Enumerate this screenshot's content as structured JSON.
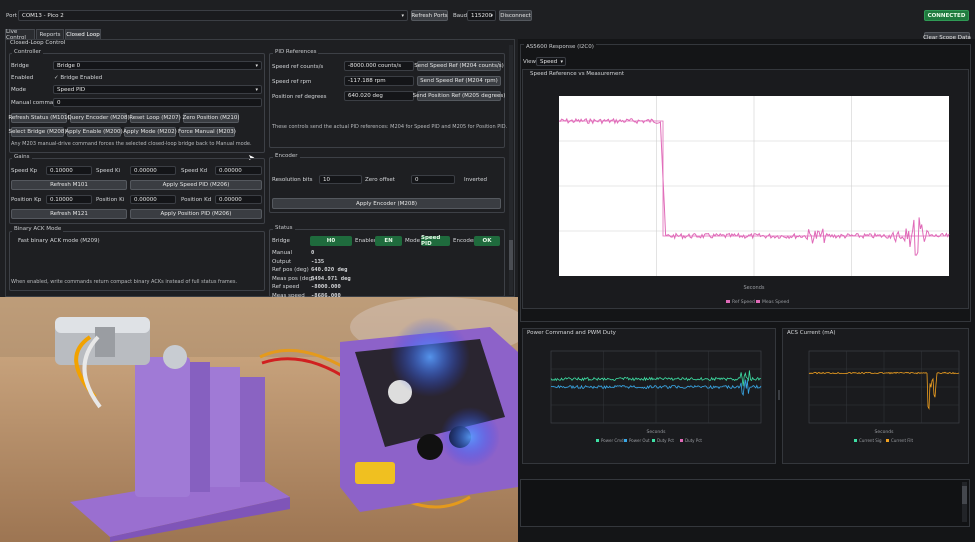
{
  "topbar": {
    "port_label": "Port",
    "port_value": "COM13 - Pico 2",
    "refresh_ports": "Refresh Ports",
    "baud_label": "Baud",
    "baud_value": "115200",
    "disconnect": "Disconnect",
    "status": "CONNECTED",
    "clear_scope": "Clear Scope Data"
  },
  "tabs": [
    "Live Control",
    "Reports",
    "Closed Loop"
  ],
  "closed_loop": {
    "title": "Closed-Loop Control",
    "controller": {
      "title": "Controller",
      "bridge_label": "Bridge",
      "bridge_value": "Bridge 0",
      "enabled_label": "Enabled",
      "enabled_check": "✓ Bridge Enabled",
      "mode_label": "Mode",
      "mode_value": "Speed PID",
      "manual_label": "Manual command",
      "manual_value": "0",
      "buttons_row1": [
        "Refresh Status (M101)",
        "Query Encoder (M208)",
        "Reset Loop (M207)",
        "Zero Position (M210)"
      ],
      "buttons_row2": [
        "Select Bridge (M208)",
        "Apply Enable (M200)",
        "Apply Mode (M202)",
        "Force Manual (M203)"
      ],
      "note": "Any M203 manual-drive command forces the selected closed-loop bridge back to Manual mode."
    },
    "gains": {
      "title": "Gains",
      "speed_kp_label": "Speed Kp",
      "speed_kp": "0.10000",
      "speed_ki_label": "Speed Ki",
      "speed_ki": "0.00000",
      "speed_kd_label": "Speed Kd",
      "speed_kd": "0.00000",
      "refresh_m101": "Refresh M101",
      "apply_speed": "Apply Speed PID (M206)",
      "pos_kp_label": "Position Kp",
      "pos_kp": "0.10000",
      "pos_ki_label": "Position Ki",
      "pos_ki": "0.00000",
      "pos_kd_label": "Position Kd",
      "pos_kd": "0.00000",
      "refresh_m121": "Refresh M121",
      "apply_position": "Apply Position PID (M206)"
    },
    "binary": {
      "title": "Binary ACK Mode",
      "check": "Fast binary ACK mode (M209)",
      "note": "When enabled, write commands return compact binary ACKs instead of full status frames."
    },
    "pid_refs": {
      "title": "PID References",
      "speed_counts_label": "Speed ref counts/s",
      "speed_counts": "-8000.000 counts/s",
      "send_speed_counts": "Send Speed Ref (M204 counts/s)",
      "speed_rpm_label": "Speed ref rpm",
      "speed_rpm": "-117.188 rpm",
      "send_speed_rpm": "Send Speed Ref (M204 rpm)",
      "pos_deg_label": "Position ref degrees",
      "pos_deg": "640.020 deg",
      "send_pos_deg": "Send Position Ref (M205 degrees)",
      "note": "These controls send the actual PID references: M204 for Speed PID and M205 for Position PID."
    },
    "encoder": {
      "title": "Encoder",
      "resolution_label": "Resolution bits",
      "resolution": "10",
      "zero_label": "Zero offset",
      "zero": "0",
      "inverted_label": "Inverted",
      "apply": "Apply Encoder (M208)"
    },
    "status": {
      "title": "Status",
      "bridge_label": "Bridge",
      "bridge": "H0",
      "enabled_label": "Enabled",
      "enabled": "EN",
      "mode_label": "Mode",
      "mode": "Speed PID",
      "encoder_label": "Encoder",
      "encoder": "OK",
      "rows": [
        {
          "k": "Manual",
          "v": "0"
        },
        {
          "k": "Output",
          "v": "-135"
        },
        {
          "k": "Ref pos (deg)",
          "v": "640.020 deg"
        },
        {
          "k": "Meas pos (deg)",
          "v": "5494.971 deg"
        },
        {
          "k": "Ref speed",
          "v": "-8000.000"
        },
        {
          "k": "Meas speed",
          "v": "-8686.000"
        }
      ]
    }
  },
  "scope": {
    "title": "AS5600 Response (I2C0)",
    "view_label": "View",
    "view_value": "Speed",
    "main_chart_title": "Speed Reference vs Measurement",
    "main_xlabel": "Seconds",
    "main_legend": [
      "Ref Speed",
      "Meas Speed"
    ],
    "power_title": "Power Command and PWM Duty",
    "power_xlabel": "Seconds",
    "power_legend": [
      "Power Cmd",
      "Power Out",
      "Duty Pct",
      "Duty Pct"
    ],
    "acs_title": "ACS Current (mA)",
    "acs_xlabel": "Seconds",
    "acs_legend": [
      "Current Sig",
      "Current Filt"
    ]
  },
  "colors": {
    "ref": "#e06ab8",
    "meas": "#e06ab8",
    "power_green": "#3ee0a5",
    "power_blue": "#38a8e8",
    "acs": "#f0a020",
    "accent": "#1f6b3d"
  },
  "icons": [
    "chevron-down-icon",
    "check-icon",
    "camera-photo"
  ]
}
